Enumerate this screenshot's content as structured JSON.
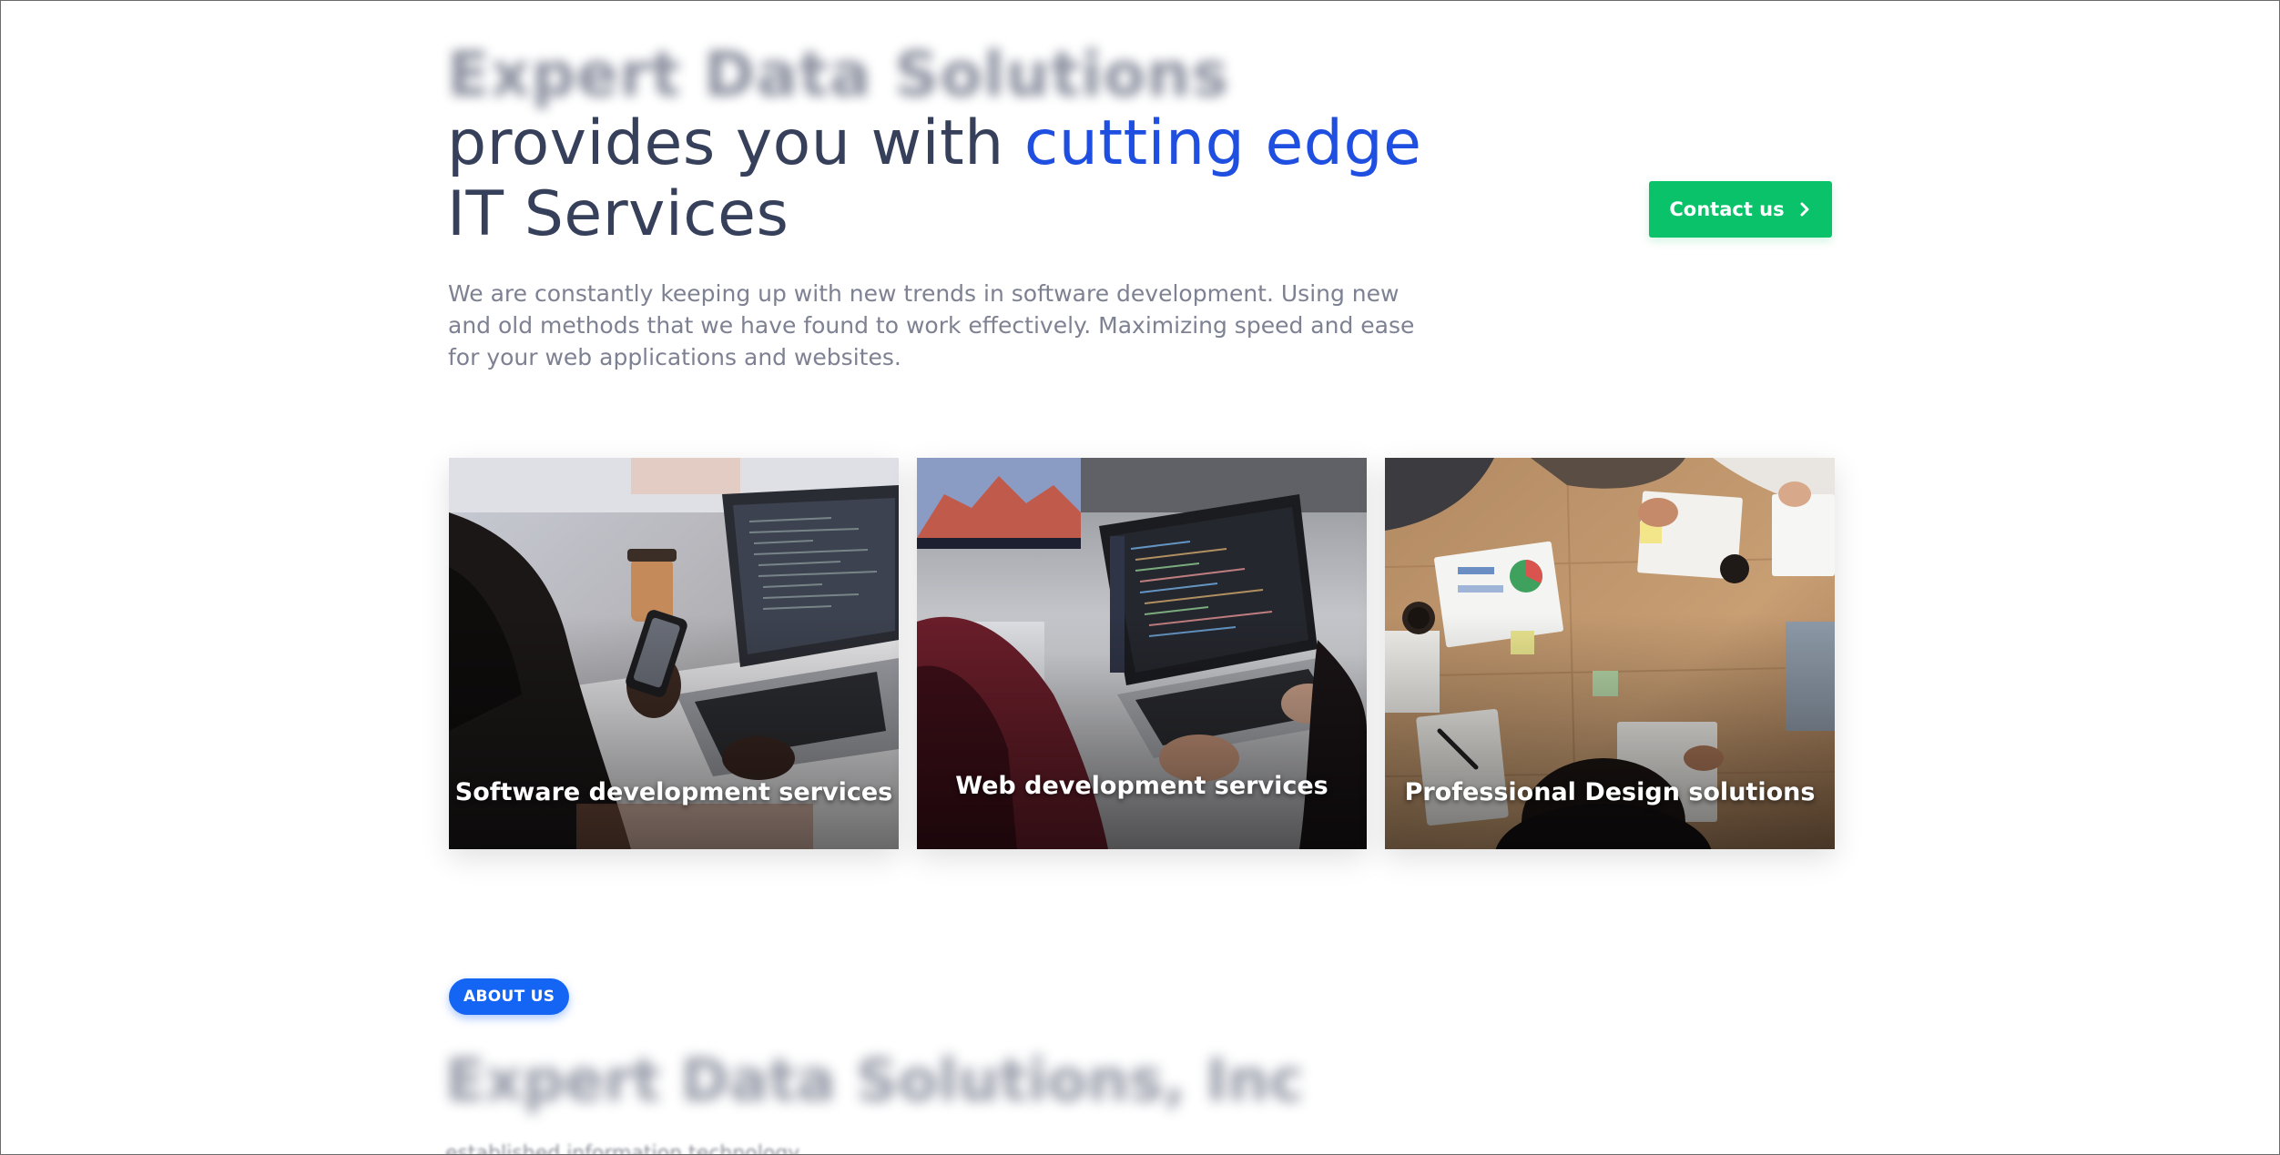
{
  "hero": {
    "blurred_heading": "Expert Data Solutions",
    "title_part1": "provides you with ",
    "title_accent": "cutting edge",
    "title_part2": "IT Services",
    "description": "We are constantly keeping up with new trends in software development. Using new and old methods that we have found to work effectively. Maximizing speed and ease for your web applications and websites."
  },
  "contact_button": {
    "label": "Contact us",
    "icon": "chevron-right-icon"
  },
  "cards": [
    {
      "label": "Software development services",
      "image": "person-with-phone-and-laptop-photo"
    },
    {
      "label": "Web development services",
      "image": "laptop-with-code-photo"
    },
    {
      "label": "Professional Design solutions",
      "image": "team-meeting-table-photo"
    }
  ],
  "about": {
    "badge": "ABOUT US",
    "blurred_title": "Expert Data Solutions, Inc",
    "blurred_text": "established information technology"
  },
  "colors": {
    "heading": "#37405a",
    "accent": "#1f4fe0",
    "button_green": "#0ac26a",
    "badge_blue": "#1565f5",
    "body_text": "#7d8192"
  }
}
